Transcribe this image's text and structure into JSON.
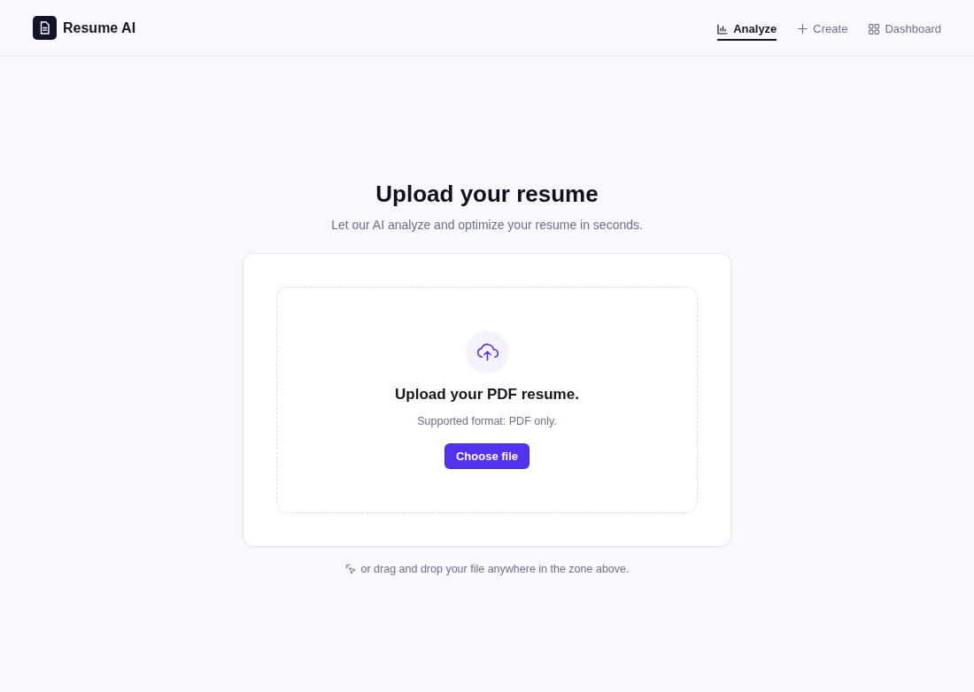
{
  "header": {
    "brand": "Resume AI",
    "tabs": [
      {
        "label": "Analyze",
        "selected": true
      },
      {
        "label": "Create",
        "selected": false
      },
      {
        "label": "Dashboard",
        "selected": false
      }
    ]
  },
  "hero": {
    "title": "Upload your resume",
    "subtitle": "Let our AI analyze and optimize your resume in seconds."
  },
  "upload_card": {
    "title": "Upload your PDF resume.",
    "note": "Supported format: PDF only.",
    "button": "Choose file"
  },
  "hint": "or drag and drop your file anywhere in the zone above."
}
